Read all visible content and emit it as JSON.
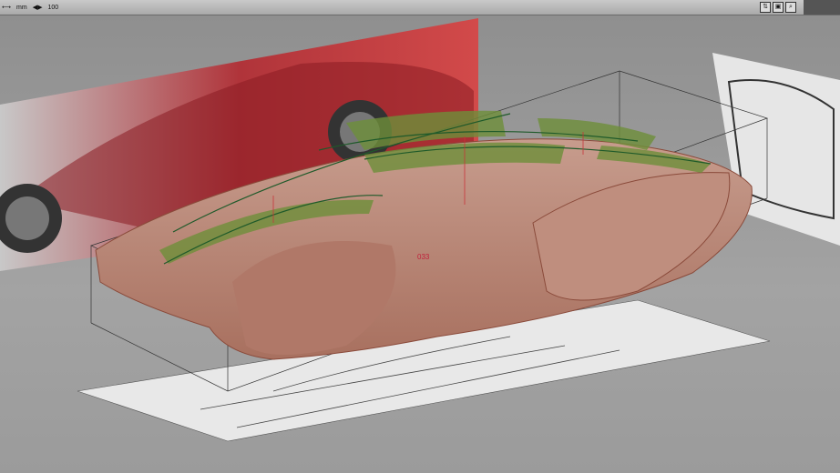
{
  "toolbar": {
    "unit_label": "mm",
    "zoom_value": "100",
    "icons": [
      "fit-view-icon",
      "frame-icon",
      "zoom-icon"
    ]
  },
  "viewport": {
    "section_label": "033",
    "colors": {
      "background": "#9a9a9a",
      "mesh": "#b98a7a",
      "curves": "#1f5a2a",
      "ribbons": "#6e8f3a",
      "sketch": "#c8343a"
    }
  }
}
